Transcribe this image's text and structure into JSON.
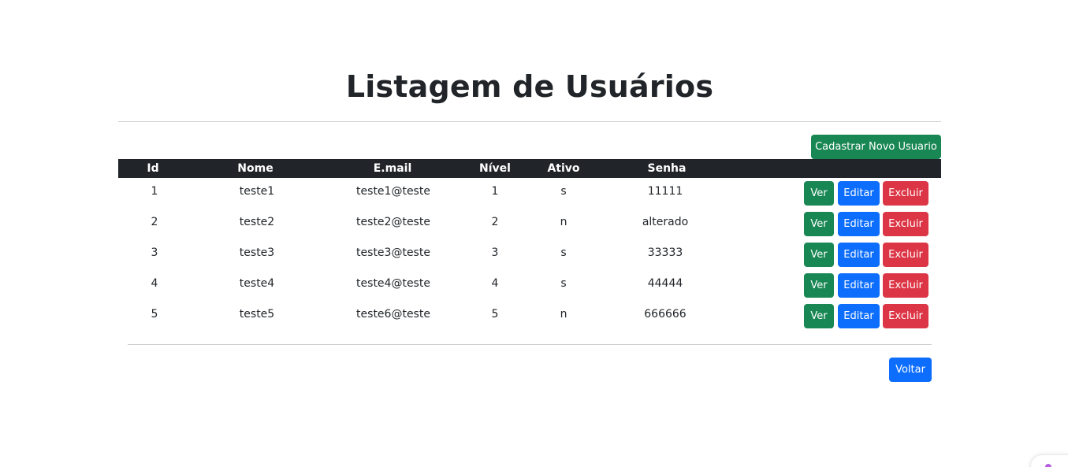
{
  "page": {
    "title": "Listagem de Usuários"
  },
  "toolbar": {
    "new_user_label": "Cadastrar Novo Usuario"
  },
  "table": {
    "headers": [
      "Id",
      "Nome",
      "E.mail",
      "Nível",
      "Ativo",
      "Senha"
    ],
    "rows": [
      {
        "id": "1",
        "nome": "teste1",
        "email": "teste1@teste",
        "nivel": "1",
        "ativo": "s",
        "senha": "11111"
      },
      {
        "id": "2",
        "nome": "teste2",
        "email": "teste2@teste",
        "nivel": "2",
        "ativo": "n",
        "senha": "alterado"
      },
      {
        "id": "3",
        "nome": "teste3",
        "email": "teste3@teste",
        "nivel": "3",
        "ativo": "s",
        "senha": "33333"
      },
      {
        "id": "4",
        "nome": "teste4",
        "email": "teste4@teste",
        "nivel": "4",
        "ativo": "s",
        "senha": "44444"
      },
      {
        "id": "5",
        "nome": "teste5",
        "email": "teste6@teste",
        "nivel": "5",
        "ativo": "n",
        "senha": "666666"
      }
    ],
    "actions": {
      "view_label": "Ver",
      "edit_label": "Editar",
      "delete_label": "Excluir"
    }
  },
  "footer": {
    "back_label": "Voltar"
  },
  "colors": {
    "success": "#198754",
    "primary": "#0d6efd",
    "danger": "#dc3545",
    "header_bg": "#212529"
  }
}
